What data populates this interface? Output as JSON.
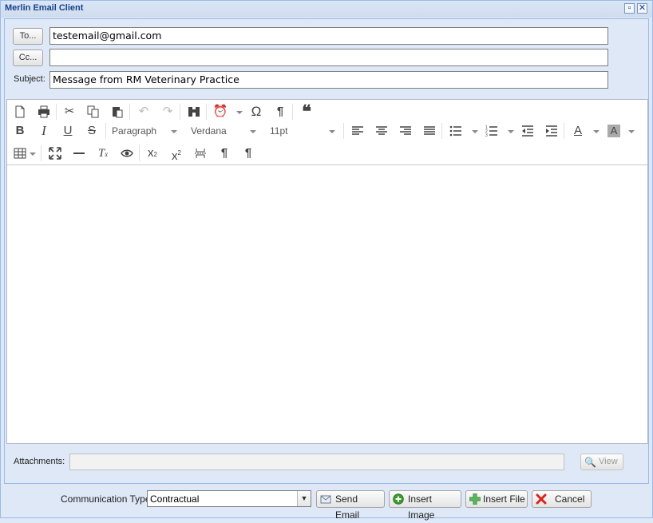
{
  "window": {
    "title": "Merlin Email Client"
  },
  "header": {
    "to_button": "To...",
    "cc_button": "Cc...",
    "to_value": "testemail@gmail.com",
    "cc_value": "",
    "subject_label": "Subject:",
    "subject_value": "Message from RM Veterinary Practice"
  },
  "toolbar": {
    "format_dropdown": "Paragraph",
    "font_dropdown": "Verdana",
    "size_dropdown": "11pt",
    "icons_row1": [
      "new-document-icon",
      "print-icon",
      "cut-icon",
      "copy-icon",
      "paste-icon",
      "undo-icon",
      "redo-icon",
      "find-replace-icon",
      "insert-time-icon",
      "special-character-icon",
      "show-blocks-icon",
      "blockquote-icon"
    ],
    "icons_row2": [
      "bold-icon",
      "italic-icon",
      "underline-icon",
      "strikethrough-icon",
      "align-left-icon",
      "align-center-icon",
      "align-right-icon",
      "align-justify-icon",
      "bullet-list-icon",
      "numbered-list-icon",
      "outdent-icon",
      "indent-icon",
      "text-color-icon",
      "background-color-icon"
    ],
    "icons_row3": [
      "table-icon",
      "fullscreen-icon",
      "horizontal-rule-icon",
      "clear-formatting-icon",
      "preview-icon",
      "subscript-icon",
      "superscript-icon",
      "page-break-icon",
      "ltr-icon",
      "rtl-icon"
    ]
  },
  "attachments": {
    "label": "Attachments:",
    "value": "",
    "view_button": "View"
  },
  "footer": {
    "communication_type_label": "Communication Type",
    "communication_type_value": "Contractual",
    "send_button": "Send Email",
    "insert_image_button": "Insert Image",
    "insert_file_button": "Insert File",
    "cancel_button": "Cancel"
  }
}
